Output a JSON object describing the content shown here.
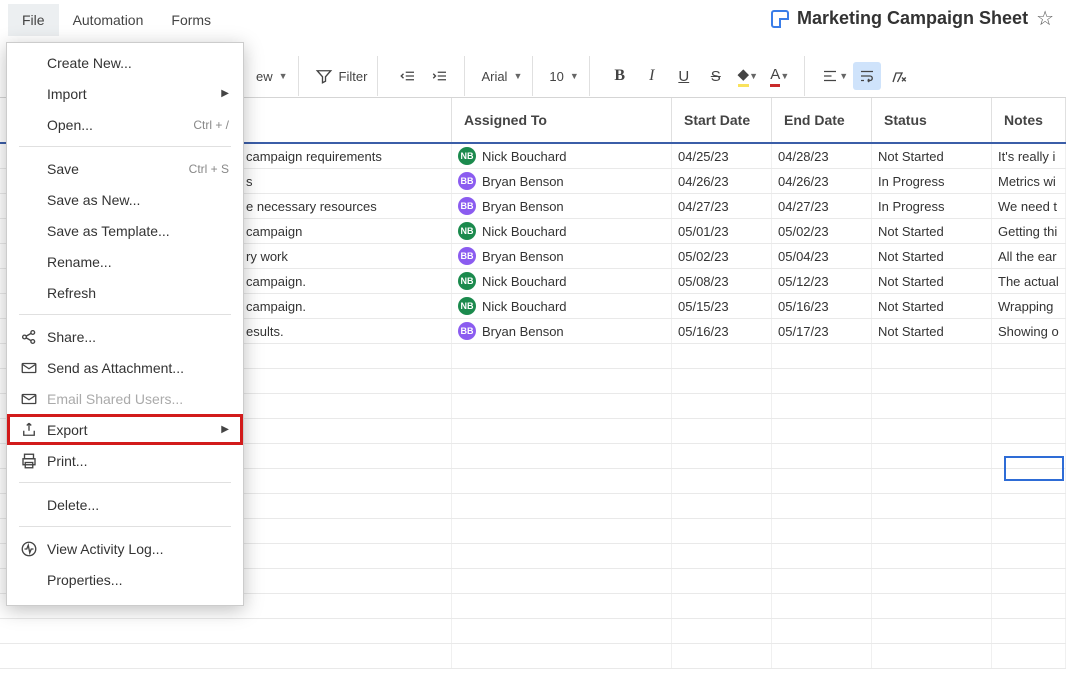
{
  "top_menu": {
    "items": [
      "File",
      "Automation",
      "Forms"
    ],
    "active_index": 0
  },
  "sheet": {
    "title": "Marketing Campaign Sheet"
  },
  "toolbar": {
    "view_dropdown": "ew",
    "filter_label": "Filter",
    "font_name": "Arial",
    "font_size": "10"
  },
  "grid": {
    "headers": [
      "",
      "Assigned To",
      "Start Date",
      "End Date",
      "Status",
      "Notes"
    ],
    "rows": [
      {
        "task": "campaign requirements",
        "assignee": "Nick Bouchard",
        "initials": "NB",
        "color": "#1b8a4d",
        "start": "04/25/23",
        "end": "04/28/23",
        "status": "Not Started",
        "notes": "It's really i"
      },
      {
        "task": "s",
        "assignee": "Bryan Benson",
        "initials": "BB",
        "color": "#8b5cf0",
        "start": "04/26/23",
        "end": "04/26/23",
        "status": "In Progress",
        "notes": "Metrics wi"
      },
      {
        "task": "e necessary resources",
        "assignee": "Bryan Benson",
        "initials": "BB",
        "color": "#8b5cf0",
        "start": "04/27/23",
        "end": "04/27/23",
        "status": "In Progress",
        "notes": "We need t"
      },
      {
        "task": "campaign",
        "assignee": "Nick Bouchard",
        "initials": "NB",
        "color": "#1b8a4d",
        "start": "05/01/23",
        "end": "05/02/23",
        "status": "Not Started",
        "notes": "Getting thi"
      },
      {
        "task": "ry work",
        "assignee": "Bryan Benson",
        "initials": "BB",
        "color": "#8b5cf0",
        "start": "05/02/23",
        "end": "05/04/23",
        "status": "Not Started",
        "notes": "All the ear"
      },
      {
        "task": "campaign.",
        "assignee": "Nick Bouchard",
        "initials": "NB",
        "color": "#1b8a4d",
        "start": "05/08/23",
        "end": "05/12/23",
        "status": "Not Started",
        "notes": "The actual"
      },
      {
        "task": "campaign.",
        "assignee": "Nick Bouchard",
        "initials": "NB",
        "color": "#1b8a4d",
        "start": "05/15/23",
        "end": "05/16/23",
        "status": "Not Started",
        "notes": "Wrapping"
      },
      {
        "task": "esults.",
        "assignee": "Bryan Benson",
        "initials": "BB",
        "color": "#8b5cf0",
        "start": "05/16/23",
        "end": "05/17/23",
        "status": "Not Started",
        "notes": "Showing o"
      }
    ],
    "empty_rows": 13
  },
  "file_menu": {
    "items": [
      {
        "label": "Create New...",
        "icon": "",
        "shortcut": "",
        "submenu": false
      },
      {
        "label": "Import",
        "icon": "",
        "shortcut": "",
        "submenu": true
      },
      {
        "label": "Open...",
        "icon": "",
        "shortcut": "Ctrl + /",
        "submenu": false
      },
      {
        "type": "sep"
      },
      {
        "label": "Save",
        "icon": "",
        "shortcut": "Ctrl + S",
        "submenu": false
      },
      {
        "label": "Save as New...",
        "icon": "",
        "shortcut": "",
        "submenu": false
      },
      {
        "label": "Save as Template...",
        "icon": "",
        "shortcut": "",
        "submenu": false
      },
      {
        "label": "Rename...",
        "icon": "",
        "shortcut": "",
        "submenu": false
      },
      {
        "label": "Refresh",
        "icon": "",
        "shortcut": "",
        "submenu": false
      },
      {
        "type": "sep"
      },
      {
        "label": "Share...",
        "icon": "share",
        "shortcut": "",
        "submenu": false
      },
      {
        "label": "Send as Attachment...",
        "icon": "mail",
        "shortcut": "",
        "submenu": false
      },
      {
        "label": "Email Shared Users...",
        "icon": "mail",
        "shortcut": "",
        "submenu": false,
        "disabled": true
      },
      {
        "label": "Export",
        "icon": "export",
        "shortcut": "",
        "submenu": true,
        "highlighted": true
      },
      {
        "label": "Print...",
        "icon": "print",
        "shortcut": "",
        "submenu": false
      },
      {
        "type": "sep"
      },
      {
        "label": "Delete...",
        "icon": "",
        "shortcut": "",
        "submenu": false
      },
      {
        "type": "sep"
      },
      {
        "label": "View Activity Log...",
        "icon": "activity",
        "shortcut": "",
        "submenu": false
      },
      {
        "label": "Properties...",
        "icon": "",
        "shortcut": "",
        "submenu": false
      }
    ]
  }
}
